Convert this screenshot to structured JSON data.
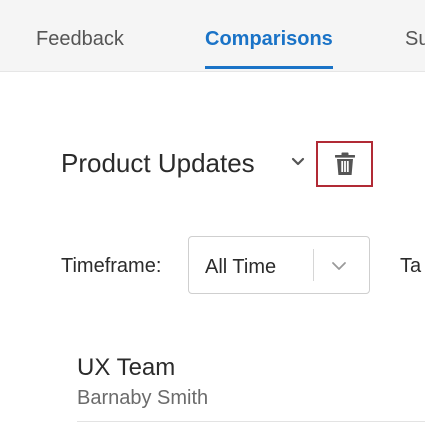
{
  "tabs": [
    {
      "label": "Feedback",
      "active": false
    },
    {
      "label": "Comparisons",
      "active": true
    },
    {
      "label": "Su",
      "active": false
    }
  ],
  "colors": {
    "accent": "#1a73c7",
    "highlight_border": "#b12a35",
    "tab_bar_bg": "#f5f5f5"
  },
  "comparison": {
    "title": "Product Updates",
    "chevron_icon": "chevron-down-icon",
    "delete_icon": "trash-icon"
  },
  "filters": {
    "timeframe_label": "Timeframe:",
    "timeframe_value": "All Time",
    "next_label": "Ta"
  },
  "team": {
    "name": "UX Team",
    "owner": "Barnaby Smith"
  }
}
